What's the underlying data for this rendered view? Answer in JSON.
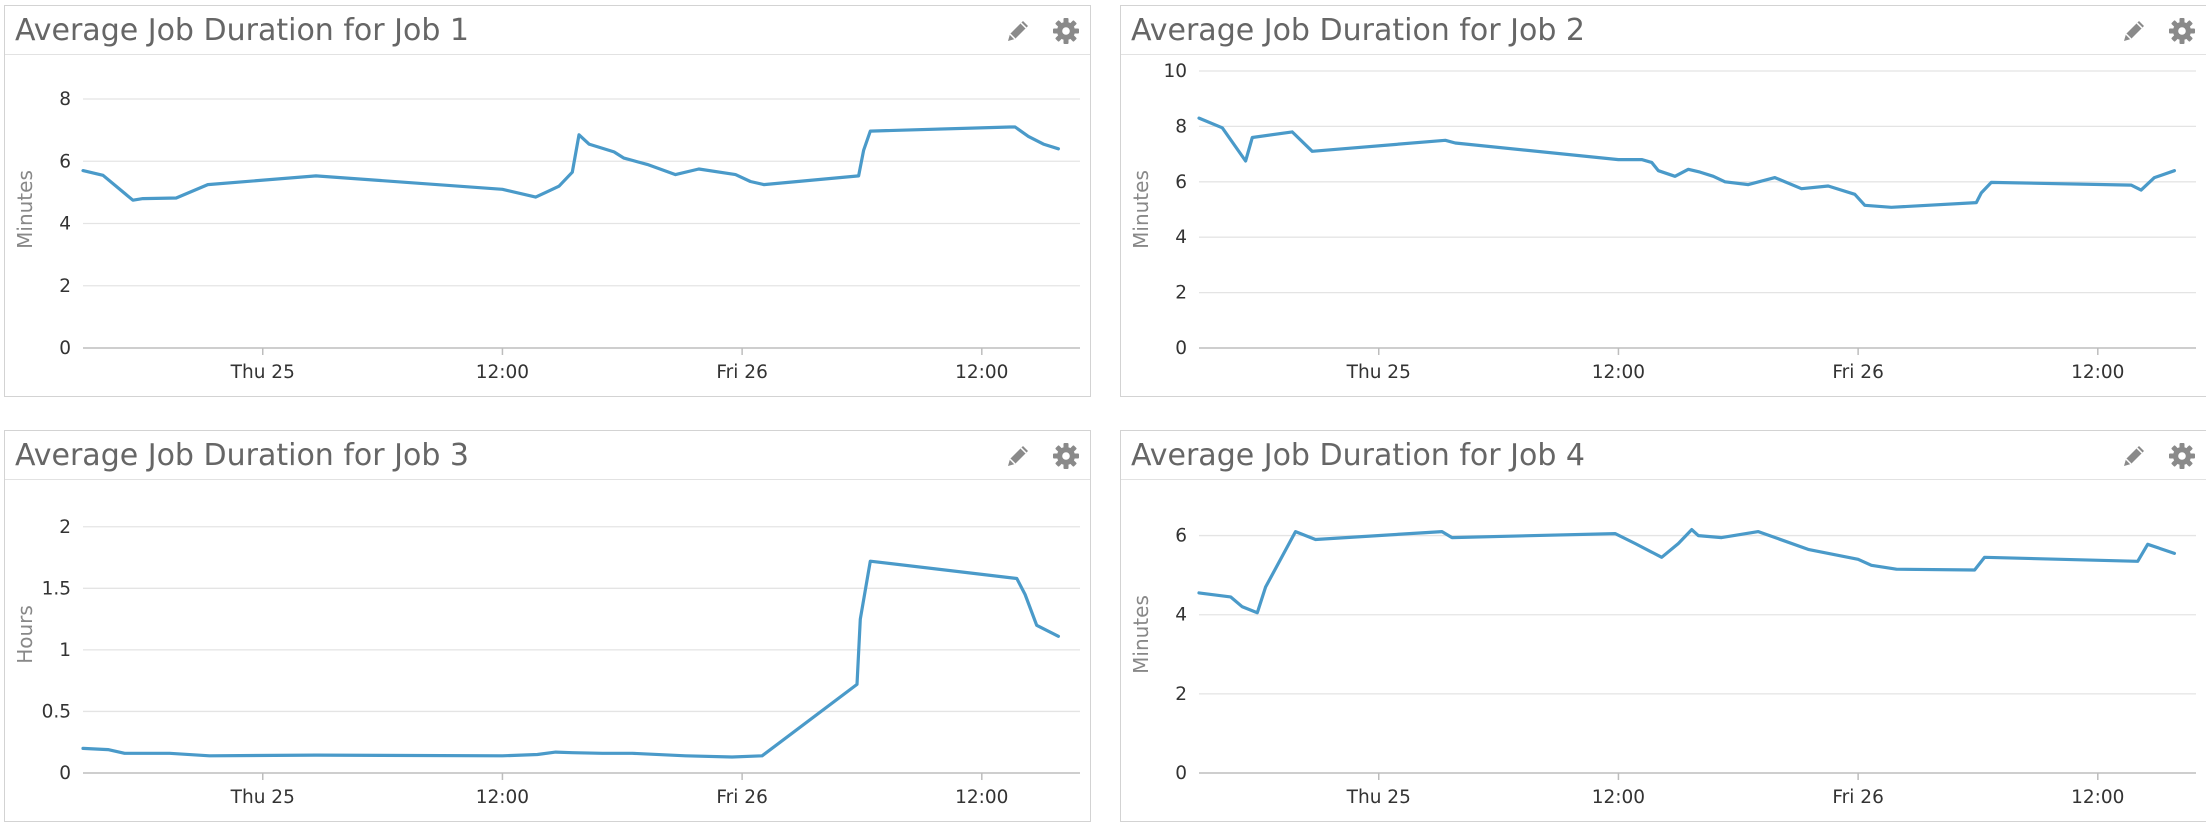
{
  "panels": [
    {
      "title": "Average Job Duration for Job 1",
      "edit_icon": "pencil-icon",
      "settings_icon": "gear-icon"
    },
    {
      "title": "Average Job Duration for Job 2",
      "edit_icon": "pencil-icon",
      "settings_icon": "gear-icon"
    },
    {
      "title": "Average Job Duration for Job 3",
      "edit_icon": "pencil-icon",
      "settings_icon": "gear-icon"
    },
    {
      "title": "Average Job Duration for Job 4",
      "edit_icon": "pencil-icon",
      "settings_icon": "gear-icon"
    }
  ],
  "colors": {
    "line": "#4a9ac9",
    "grid": "#e4e4e4",
    "axis": "#bdbdbd",
    "icon": "#8a8a8a"
  },
  "chart_data": [
    {
      "type": "line",
      "title": "Average Job Duration for Job 1",
      "ylabel": "Minutes",
      "ylim": [
        0,
        8.9
      ],
      "yticks": [
        0,
        2,
        4,
        6,
        8
      ],
      "xlim": [
        "2024-04-24 15:00",
        "2024-04-26 16:55"
      ],
      "xticks": [
        {
          "label": "Thu 25",
          "x": "2024-04-25 00:00"
        },
        {
          "label": "12:00",
          "x": "2024-04-25 12:00"
        },
        {
          "label": "Fri 26",
          "x": "2024-04-26 00:00"
        },
        {
          "label": "12:00",
          "x": "2024-04-26 12:00"
        }
      ],
      "grid": true,
      "series": [
        {
          "x": [
            "2024-04-24 15:00",
            "2024-04-24 16:00",
            "2024-04-24 17:30",
            "2024-04-24 18:00",
            "2024-04-24 19:40",
            "2024-04-24 21:15",
            "2024-04-25 02:40",
            "2024-04-25 12:00",
            "2024-04-25 13:40",
            "2024-04-25 14:10",
            "2024-04-25 14:50",
            "2024-04-25 15:30",
            "2024-04-25 15:50",
            "2024-04-25 16:20",
            "2024-04-25 17:35",
            "2024-04-25 18:05",
            "2024-04-25 19:15",
            "2024-04-25 20:40",
            "2024-04-25 21:50",
            "2024-04-25 23:40",
            "2024-04-26 00:25",
            "2024-04-26 01:05",
            "2024-04-26 05:50",
            "2024-04-26 06:05",
            "2024-04-26 06:25",
            "2024-04-26 13:25",
            "2024-04-26 13:40",
            "2024-04-26 14:20",
            "2024-04-26 15:05",
            "2024-04-26 15:50"
          ],
          "y": [
            5.7,
            5.55,
            4.75,
            4.8,
            4.82,
            5.25,
            5.53,
            5.1,
            4.85,
            5.0,
            5.2,
            5.65,
            6.85,
            6.55,
            6.3,
            6.1,
            5.9,
            5.57,
            5.75,
            5.57,
            5.35,
            5.25,
            5.53,
            6.35,
            6.97,
            7.1,
            7.1,
            6.8,
            6.55,
            6.4
          ]
        }
      ]
    },
    {
      "type": "line",
      "title": "Average Job Duration for Job 2",
      "ylabel": "Minutes",
      "ylim": [
        0,
        10
      ],
      "yticks": [
        0,
        2,
        4,
        6,
        8,
        10
      ],
      "xlim": [
        "2024-04-24 15:00",
        "2024-04-26 16:55"
      ],
      "xticks": [
        {
          "label": "Thu 25",
          "x": "2024-04-25 00:00"
        },
        {
          "label": "12:00",
          "x": "2024-04-25 12:00"
        },
        {
          "label": "Fri 26",
          "x": "2024-04-26 00:00"
        },
        {
          "label": "12:00",
          "x": "2024-04-26 12:00"
        }
      ],
      "grid": true,
      "series": [
        {
          "x": [
            "2024-04-24 15:00",
            "2024-04-24 16:10",
            "2024-04-24 17:20",
            "2024-04-24 17:40",
            "2024-04-24 19:40",
            "2024-04-24 20:40",
            "2024-04-25 03:20",
            "2024-04-25 03:50",
            "2024-04-25 12:00",
            "2024-04-25 13:10",
            "2024-04-25 13:40",
            "2024-04-25 14:00",
            "2024-04-25 14:50",
            "2024-04-25 15:30",
            "2024-04-25 16:05",
            "2024-04-25 16:45",
            "2024-04-25 17:20",
            "2024-04-25 18:30",
            "2024-04-25 19:50",
            "2024-04-25 21:10",
            "2024-04-25 22:30",
            "2024-04-25 23:50",
            "2024-04-26 00:20",
            "2024-04-26 01:40",
            "2024-04-26 05:55",
            "2024-04-26 06:10",
            "2024-04-26 06:40",
            "2024-04-26 13:40",
            "2024-04-26 14:10",
            "2024-04-26 14:50",
            "2024-04-26 15:50"
          ],
          "y": [
            8.3,
            7.95,
            6.75,
            7.6,
            7.8,
            7.1,
            7.5,
            7.4,
            6.8,
            6.8,
            6.7,
            6.4,
            6.2,
            6.45,
            6.35,
            6.2,
            6.0,
            5.9,
            6.15,
            5.75,
            5.85,
            5.55,
            5.15,
            5.08,
            5.25,
            5.6,
            5.98,
            5.88,
            5.7,
            6.15,
            6.4
          ]
        }
      ]
    },
    {
      "type": "line",
      "title": "Average Job Duration for Job 3",
      "ylabel": "Hours",
      "ylim": [
        0,
        2.25
      ],
      "yticks": [
        0,
        0.5,
        1,
        1.5,
        2
      ],
      "xlim": [
        "2024-04-24 15:00",
        "2024-04-26 16:55"
      ],
      "xticks": [
        {
          "label": "Thu 25",
          "x": "2024-04-25 00:00"
        },
        {
          "label": "12:00",
          "x": "2024-04-25 12:00"
        },
        {
          "label": "Fri 26",
          "x": "2024-04-26 00:00"
        },
        {
          "label": "12:00",
          "x": "2024-04-26 12:00"
        }
      ],
      "grid": true,
      "series": [
        {
          "x": [
            "2024-04-24 15:00",
            "2024-04-24 16:15",
            "2024-04-24 17:05",
            "2024-04-24 19:20",
            "2024-04-24 21:20",
            "2024-04-25 02:40",
            "2024-04-25 12:00",
            "2024-04-25 13:45",
            "2024-04-25 14:40",
            "2024-04-25 15:30",
            "2024-04-25 17:00",
            "2024-04-25 18:30",
            "2024-04-25 21:10",
            "2024-04-25 23:30",
            "2024-04-26 01:00",
            "2024-04-26 05:45",
            "2024-04-26 05:55",
            "2024-04-26 06:25",
            "2024-04-26 13:45",
            "2024-04-26 14:10",
            "2024-04-26 14:45",
            "2024-04-26 15:50"
          ],
          "y": [
            0.2,
            0.19,
            0.16,
            0.16,
            0.14,
            0.145,
            0.14,
            0.15,
            0.17,
            0.165,
            0.16,
            0.16,
            0.14,
            0.13,
            0.14,
            0.72,
            1.25,
            1.72,
            1.58,
            1.45,
            1.2,
            1.11
          ]
        }
      ]
    },
    {
      "type": "line",
      "title": "Average Job Duration for Job 4",
      "ylabel": "Minutes",
      "ylim": [
        0,
        7
      ],
      "yticks": [
        0,
        2,
        4,
        6
      ],
      "xlim": [
        "2024-04-24 15:00",
        "2024-04-26 16:55"
      ],
      "xticks": [
        {
          "label": "Thu 25",
          "x": "2024-04-25 00:00"
        },
        {
          "label": "12:00",
          "x": "2024-04-25 12:00"
        },
        {
          "label": "Fri 26",
          "x": "2024-04-26 00:00"
        },
        {
          "label": "12:00",
          "x": "2024-04-26 12:00"
        }
      ],
      "grid": true,
      "series": [
        {
          "x": [
            "2024-04-24 15:00",
            "2024-04-24 16:35",
            "2024-04-24 17:10",
            "2024-04-24 17:55",
            "2024-04-24 18:20",
            "2024-04-24 19:50",
            "2024-04-24 20:50",
            "2024-04-25 03:10",
            "2024-04-25 03:40",
            "2024-04-25 11:50",
            "2024-04-25 12:50",
            "2024-04-25 14:10",
            "2024-04-25 15:00",
            "2024-04-25 15:40",
            "2024-04-25 16:00",
            "2024-04-25 17:10",
            "2024-04-25 19:00",
            "2024-04-25 21:30",
            "2024-04-26 00:00",
            "2024-04-26 00:40",
            "2024-04-26 01:55",
            "2024-04-26 05:50",
            "2024-04-26 06:20",
            "2024-04-26 14:00",
            "2024-04-26 14:30",
            "2024-04-26 15:50"
          ],
          "y": [
            4.55,
            4.45,
            4.2,
            4.05,
            4.7,
            6.1,
            5.9,
            6.1,
            5.95,
            6.05,
            5.8,
            5.45,
            5.8,
            6.15,
            6.0,
            5.95,
            6.1,
            5.65,
            5.4,
            5.25,
            5.15,
            5.13,
            5.45,
            5.35,
            5.78,
            5.55
          ]
        }
      ]
    }
  ]
}
